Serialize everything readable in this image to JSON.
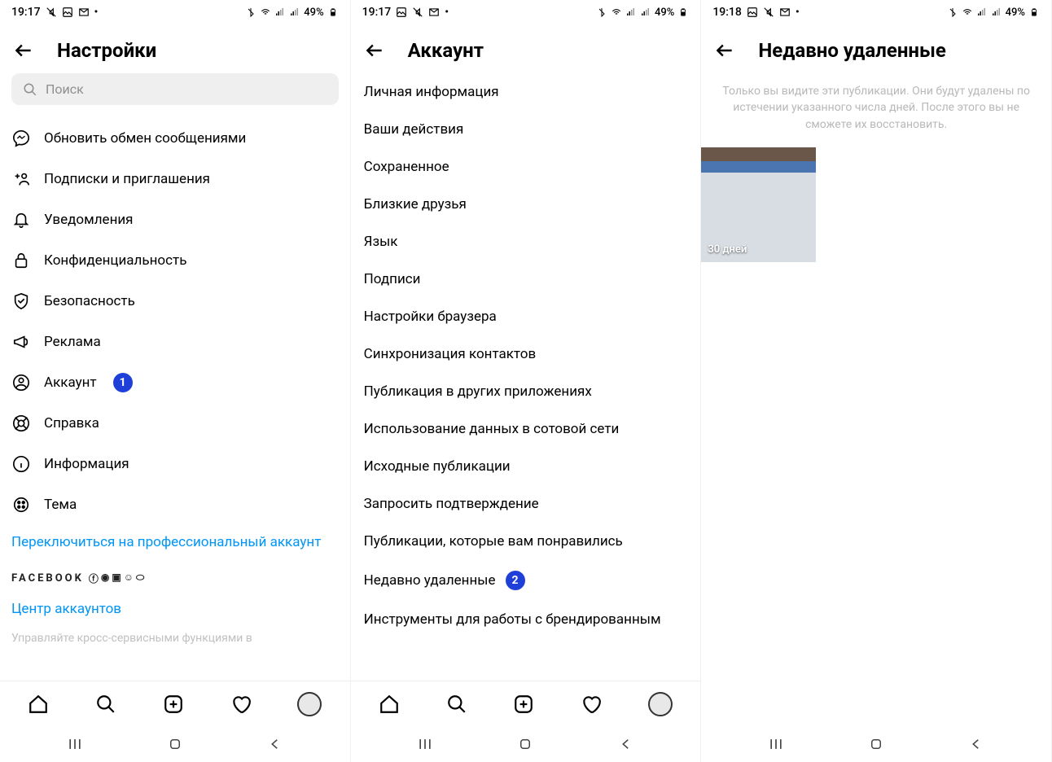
{
  "screens": [
    {
      "status": {
        "time": "19:17",
        "battery": "49%"
      },
      "title": "Настройки",
      "search_placeholder": "Поиск",
      "menu": [
        {
          "icon": "messenger",
          "label": "Обновить обмен сообщениями"
        },
        {
          "icon": "personplus",
          "label": "Подписки и приглашения"
        },
        {
          "icon": "bell",
          "label": "Уведомления"
        },
        {
          "icon": "lock",
          "label": "Конфиденциальность"
        },
        {
          "icon": "shield",
          "label": "Безопасность"
        },
        {
          "icon": "megaphone",
          "label": "Реклама"
        },
        {
          "icon": "account",
          "label": "Аккаунт",
          "badge": "1"
        },
        {
          "icon": "life",
          "label": "Справка"
        },
        {
          "icon": "info",
          "label": "Информация"
        },
        {
          "icon": "theme",
          "label": "Тема"
        }
      ],
      "pro_link": "Переключиться на профессиональный аккаунт",
      "fb_label": "FACEBOOK",
      "accounts_center": "Центр аккаунтов",
      "faded": "Управляйте кросс-сервисными функциями в"
    },
    {
      "status": {
        "time": "19:17",
        "battery": "49%"
      },
      "title": "Аккаунт",
      "items": [
        "Личная информация",
        "Ваши действия",
        "Сохраненное",
        "Близкие друзья",
        "Язык",
        "Подписи",
        "Настройки браузера",
        "Синхронизация контактов",
        "Публикация в других приложениях",
        "Использование данных в сотовой сети",
        "Исходные публикации",
        "Запросить подтверждение",
        "Публикации, которые вам понравились"
      ],
      "recently_deleted": "Недавно удаленные",
      "recently_deleted_badge": "2",
      "last_item": "Инструменты для работы с брендированным"
    },
    {
      "status": {
        "time": "19:18",
        "battery": "49%"
      },
      "title": "Недавно удаленные",
      "info": "Только вы видите эти публикации. Они будут удалены по истечении указанного числа дней. После этого вы не сможете их восстановить.",
      "thumb_label": "30 дней"
    }
  ]
}
